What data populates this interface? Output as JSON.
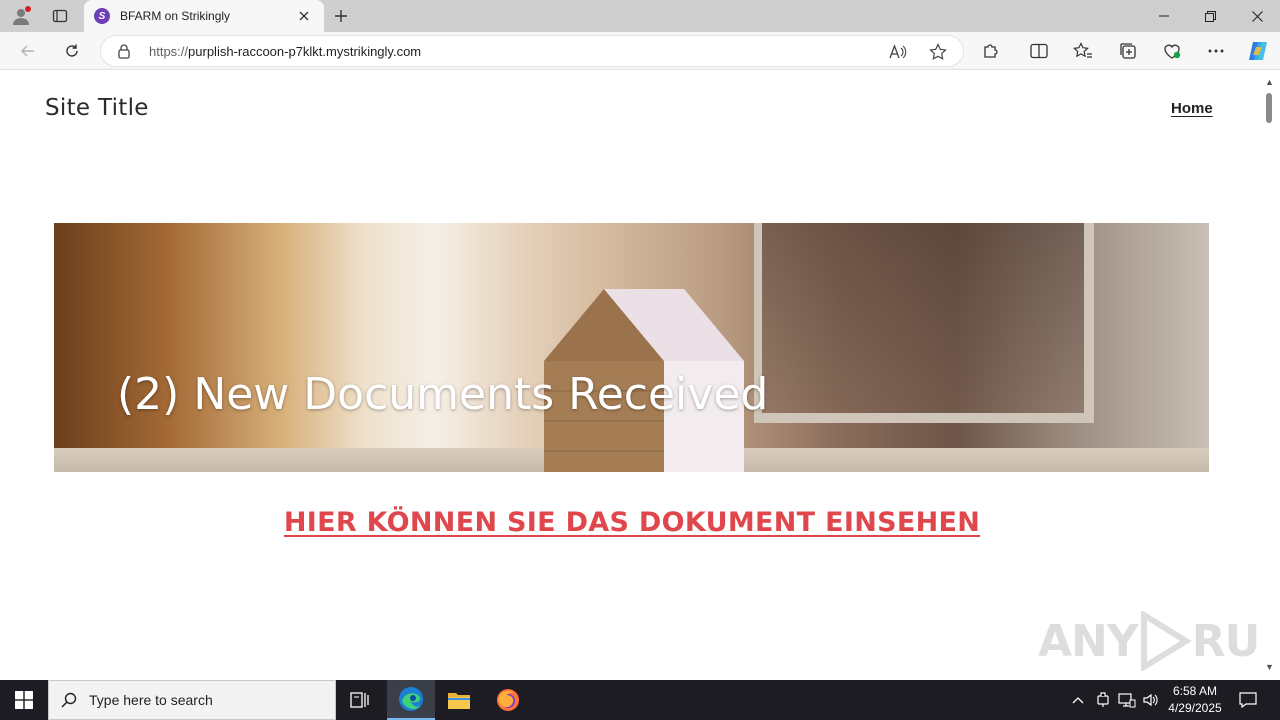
{
  "browser": {
    "tab_title": "BFARM on Strikingly",
    "tab_favicon_letter": "S",
    "url_scheme": "https://",
    "url_host": "purplish-raccoon-p7klkt.mystrikingly.com",
    "icons": [
      "profile-icon",
      "tab-actions-icon",
      "close-icon",
      "new-tab-icon",
      "minimize-icon",
      "restore-icon",
      "window-close-icon",
      "back-icon",
      "refresh-icon",
      "lock-icon",
      "read-aloud-icon",
      "favorite-star-icon",
      "extensions-icon",
      "split-screen-icon",
      "favorites-icon",
      "collections-icon",
      "browser-essentials-icon",
      "more-icon",
      "copilot-icon"
    ]
  },
  "site": {
    "title": "Site Title",
    "nav_home": "Home",
    "hero_headline": "(2) New Documents Received",
    "cta_link": "HIER KÖNNEN SIE DAS DOKUMENT EINSEHEN",
    "cta_color": "#e0474c"
  },
  "watermark": {
    "left": "ANY",
    "right": "RUN"
  },
  "taskbar": {
    "search_placeholder": "Type here to search",
    "time": "6:58 AM",
    "date": "4/29/2025"
  }
}
